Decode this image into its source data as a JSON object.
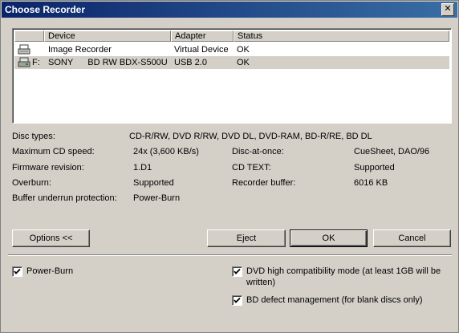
{
  "window": {
    "title": "Choose Recorder",
    "close_glyph": "✕"
  },
  "list": {
    "columns": [
      "Device",
      "Adapter",
      "Status"
    ],
    "rows": [
      {
        "prefix": "",
        "device": "Image Recorder",
        "adapter": "Virtual Device",
        "status": "OK",
        "icon": "image-recorder-icon",
        "selected": false
      },
      {
        "prefix": "F:",
        "device": "SONY      BD RW BDX-S500U",
        "adapter": "USB 2.0",
        "status": "OK",
        "icon": "drive-icon",
        "selected": true
      }
    ]
  },
  "info": {
    "disc_types_label": "Disc types:",
    "disc_types_value": "CD-R/RW, DVD R/RW, DVD DL, DVD-RAM, BD-R/RE, BD DL",
    "max_speed_label": "Maximum CD speed:",
    "max_speed_value": "24x (3,600 KB/s)",
    "dao_label": "Disc-at-once:",
    "dao_value": "CueSheet, DAO/96",
    "firmware_label": "Firmware revision:",
    "firmware_value": "1.D1",
    "cdtext_label": "CD TEXT:",
    "cdtext_value": "Supported",
    "overburn_label": "Overburn:",
    "overburn_value": "Supported",
    "buffer_label": "Recorder buffer:",
    "buffer_value": "6016 KB",
    "underrun_label": "Buffer underrun protection:",
    "underrun_value": "Power-Burn"
  },
  "buttons": {
    "options": "Options <<",
    "eject": "Eject",
    "ok": "OK",
    "cancel": "Cancel"
  },
  "options": {
    "powerburn": {
      "label": "Power-Burn",
      "checked": true
    },
    "dvd_compat": {
      "label": "DVD high compatibility mode (at least 1GB will be written)",
      "checked": true
    },
    "bd_defect": {
      "label": "BD defect management (for blank discs only)",
      "checked": true
    }
  }
}
